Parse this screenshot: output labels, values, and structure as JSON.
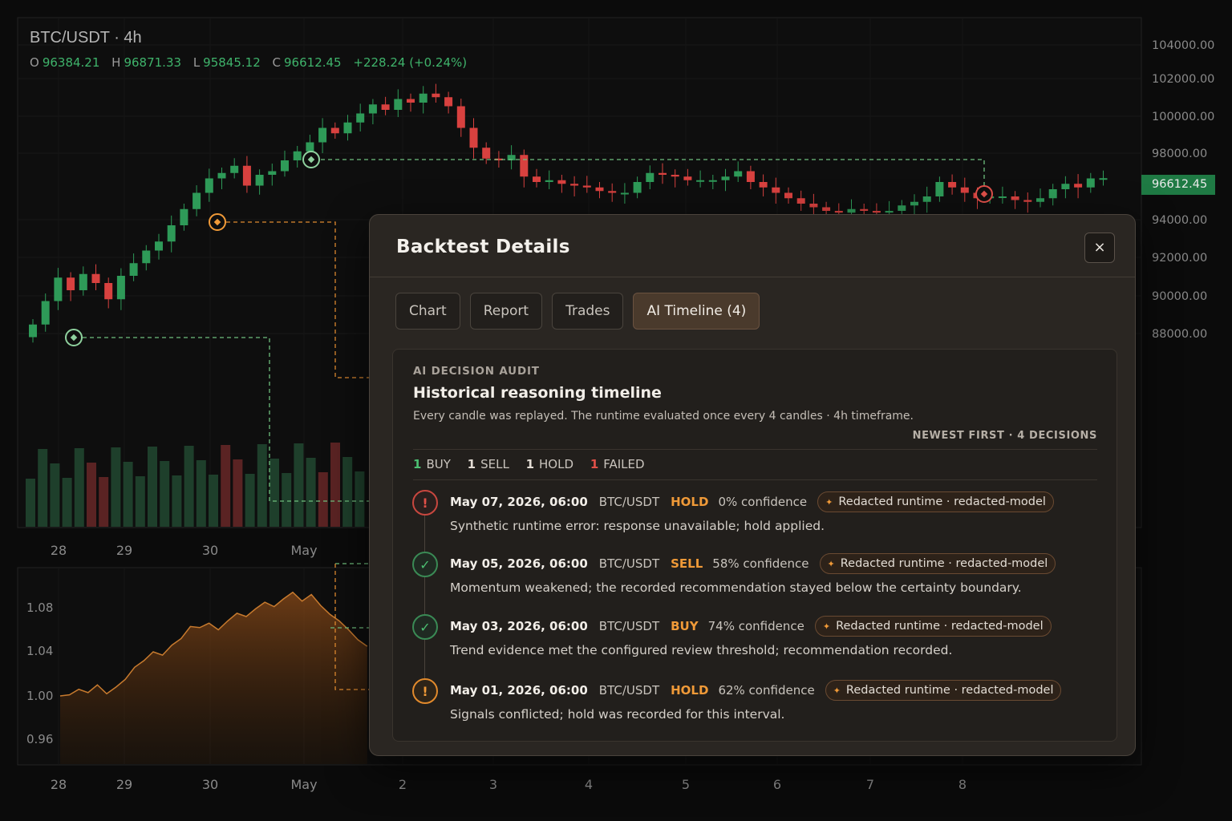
{
  "chart": {
    "symbol": "BTC/USDT · 4h",
    "ohlc": {
      "o_label": "O",
      "o": "96384.21",
      "h_label": "H",
      "h": "96871.33",
      "l_label": "L",
      "l": "95845.12",
      "c_label": "C",
      "c": "96612.45",
      "change": "+228.24 (+0.24%)"
    },
    "last_price": "96612.45",
    "price_axis": [
      "104000.00",
      "102000.00",
      "100000.00",
      "98000.00",
      "94000.00",
      "92000.00",
      "90000.00",
      "88000.00"
    ],
    "top_x_labels": [
      "28",
      "29",
      "30",
      "May"
    ],
    "bottom_x_labels": [
      "28",
      "29",
      "30",
      "May",
      "2",
      "3",
      "4",
      "5",
      "6",
      "7",
      "8"
    ],
    "equity_axis": [
      "1.08",
      "1.04",
      "1.00",
      "0.96"
    ],
    "colors": {
      "up": "#2e9a58",
      "down": "#d8413f",
      "buy_marker": "#8fd19e",
      "hold_marker": "#f09a38",
      "sell_marker": "#e0504a",
      "equity": "#c77a2e"
    }
  },
  "chart_data": {
    "type": "candlestick",
    "equity_curve": [
      1.0,
      1.001,
      1.006,
      1.003,
      1.01,
      1.002,
      1.008,
      1.015,
      1.026,
      1.032,
      1.04,
      1.037,
      1.046,
      1.052,
      1.063,
      1.062,
      1.066,
      1.06,
      1.068,
      1.075,
      1.072,
      1.079,
      1.085,
      1.081,
      1.088,
      1.094,
      1.086,
      1.092,
      1.082,
      1.074,
      1.068,
      1.06,
      1.051,
      1.045
    ]
  },
  "modal": {
    "title": "Backtest Details",
    "close_label": "×",
    "tabs": [
      "Chart",
      "Report",
      "Trades",
      "AI Timeline (4)"
    ],
    "audit_kicker": "AI DECISION AUDIT",
    "audit_title": "Historical reasoning timeline",
    "audit_sub": "Every candle was replayed. The runtime evaluated once every 4 candles · 4h timeframe.",
    "order_note": "NEWEST FIRST · 4 DECISIONS",
    "counts": [
      {
        "n": "1",
        "label": "BUY",
        "color": "#4cbf72"
      },
      {
        "n": "1",
        "label": "SELL",
        "color": "#e2dcd4"
      },
      {
        "n": "1",
        "label": "HOLD",
        "color": "#e2dcd4"
      },
      {
        "n": "1",
        "label": "FAILED",
        "color": "#e05048"
      }
    ],
    "entries": [
      {
        "date": "May 07, 2026, 06:00",
        "pair": "BTC/USDT",
        "action": "HOLD",
        "confidence": "0% confidence",
        "chip": "Redacted runtime · redacted-model",
        "message": "Synthetic runtime error: response unavailable; hold applied.",
        "node": "red",
        "icon": "!"
      },
      {
        "date": "May 05, 2026, 06:00",
        "pair": "BTC/USDT",
        "action": "SELL",
        "confidence": "58% confidence",
        "chip": "Redacted runtime · redacted-model",
        "message": "Momentum weakened; the recorded recommendation stayed below the certainty boundary.",
        "node": "green",
        "icon": "✓"
      },
      {
        "date": "May 03, 2026, 06:00",
        "pair": "BTC/USDT",
        "action": "BUY",
        "confidence": "74% confidence",
        "chip": "Redacted runtime · redacted-model",
        "message": "Trend evidence met the configured review threshold; recommendation recorded.",
        "node": "green",
        "icon": "✓"
      },
      {
        "date": "May 01, 2026, 06:00",
        "pair": "BTC/USDT",
        "action": "HOLD",
        "confidence": "62% confidence",
        "chip": "Redacted runtime · redacted-model",
        "message": "Signals conflicted; hold was recorded for this interval.",
        "node": "orange",
        "icon": "!"
      }
    ]
  }
}
